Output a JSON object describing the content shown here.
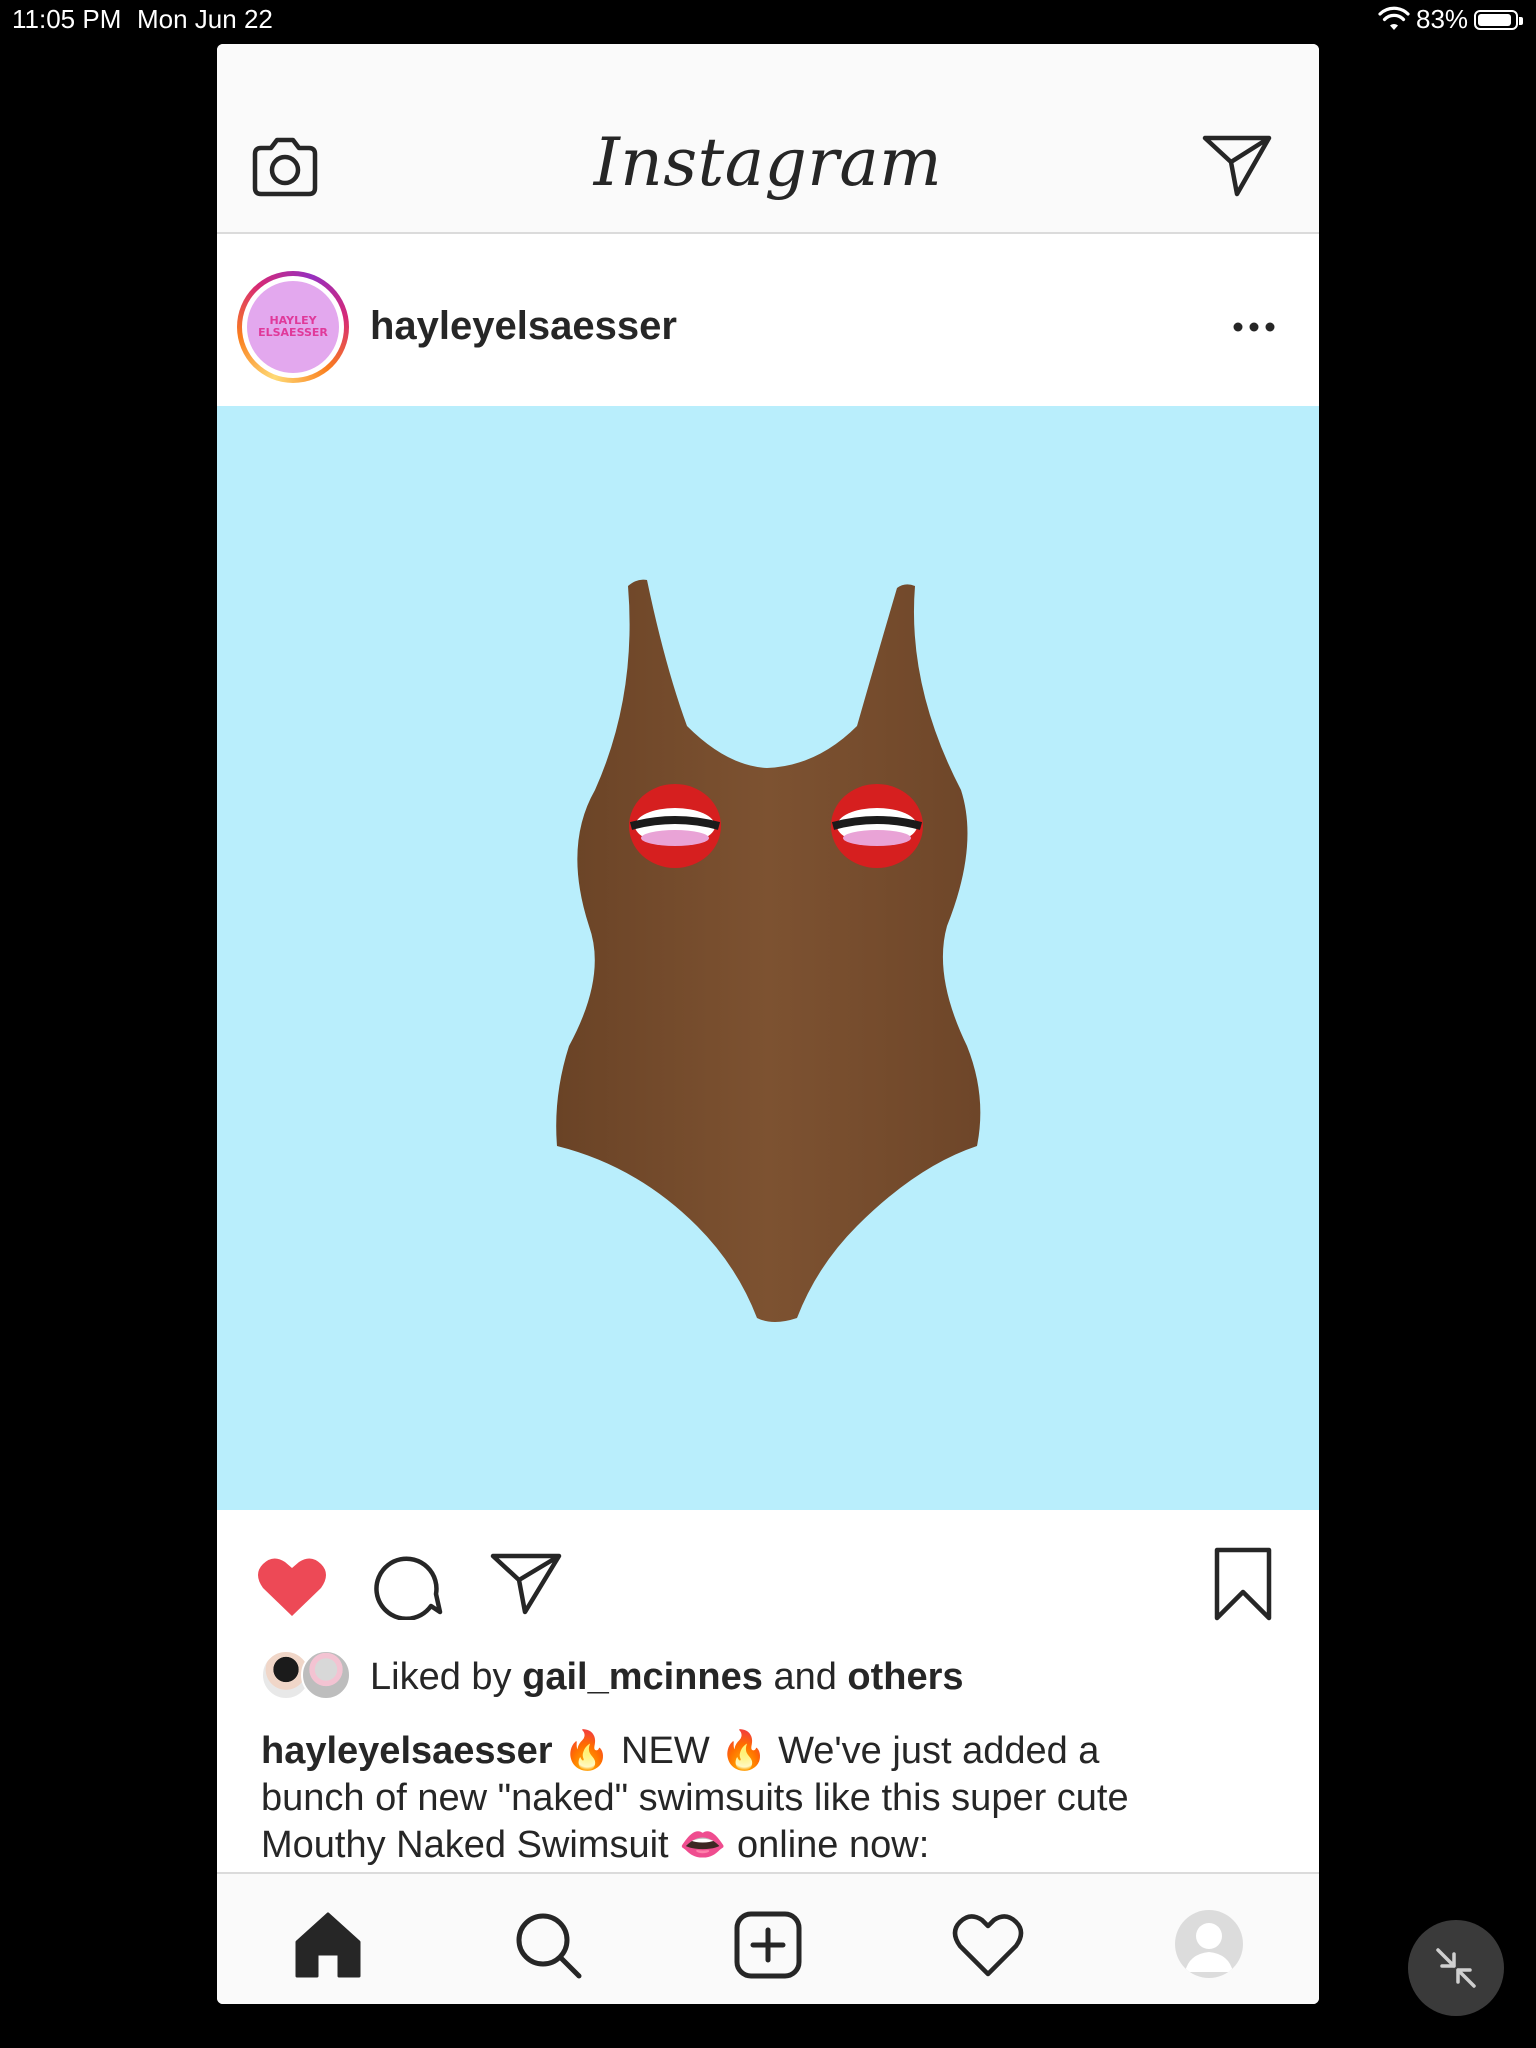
{
  "status_bar": {
    "time": "11:05 PM",
    "date": "Mon Jun 22",
    "battery": "83%"
  },
  "top_bar": {
    "title": "Instagram"
  },
  "post": {
    "username": "hayleyelsaesser",
    "avatar_text_line1": "HAYLEY",
    "avatar_text_line2": "ELSAESSER",
    "liked": true,
    "likes": {
      "prefix": "Liked by",
      "user": "gail_mcinnes",
      "conjunction": "and",
      "others": "others"
    },
    "caption": {
      "username": "hayleyelsaesser",
      "line1": "🔥 NEW 🔥 We've just added a",
      "line2": "bunch of new \"naked\" swimsuits like this super cute",
      "line3": "Mouthy Naked Swimsuit 👄 online now:"
    }
  },
  "colors": {
    "like": "#ed4956",
    "image_bg": "#b9eefc",
    "swimsuit": "#7a4f2e"
  },
  "icons": {
    "camera": "camera-icon",
    "direct": "direct-message-icon",
    "more": "more-icon",
    "like": "heart-filled-icon",
    "comment": "comment-icon",
    "share": "share-icon",
    "save": "bookmark-icon",
    "home": "home-icon",
    "search": "search-icon",
    "add": "add-post-icon",
    "activity": "heart-outline-icon",
    "profile": "profile-icon",
    "minimize": "minimize-icon"
  }
}
